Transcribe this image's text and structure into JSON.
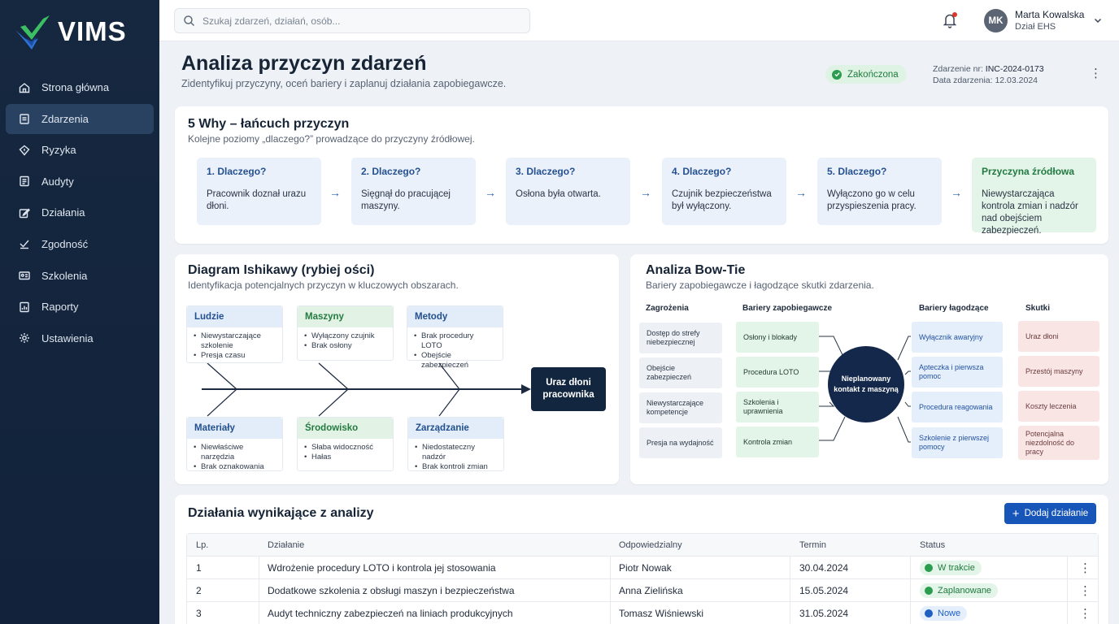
{
  "app": {
    "name": "VIMS"
  },
  "sidebar": {
    "items": [
      {
        "label": "Strona główna",
        "icon": "home-icon"
      },
      {
        "label": "Zdarzenia",
        "icon": "clipboard-icon",
        "active": true
      },
      {
        "label": "Ryzyka",
        "icon": "alert-icon"
      },
      {
        "label": "Audyty",
        "icon": "checklist-icon"
      },
      {
        "label": "Działania",
        "icon": "edit-icon"
      },
      {
        "label": "Zgodność",
        "icon": "check-icon"
      },
      {
        "label": "Szkolenia",
        "icon": "id-card-icon"
      },
      {
        "label": "Raporty",
        "icon": "report-icon"
      },
      {
        "label": "Ustawienia",
        "icon": "gear-icon"
      }
    ]
  },
  "topbar": {
    "search_placeholder": "Szukaj zdarzeń, działań, osób...",
    "user": {
      "initials": "MK",
      "name": "Marta Kowalska",
      "dept": "Dział EHS"
    }
  },
  "header": {
    "title": "Analiza przyczyn zdarzeń",
    "subtitle": "Zidentyfikuj przyczyny, oceń bariery i zaplanuj działania zapobiegawcze.",
    "status": "Zakończona",
    "event_no_label": "Zdarzenie nr:",
    "event_no": "INC-2024-0173",
    "event_date": "Data zdarzenia: 12.03.2024"
  },
  "five_why": {
    "title": "5 Why – łańcuch przyczyn",
    "subtitle": "Kolejne poziomy „dlaczego?” prowadzące do przyczyny źródłowej.",
    "steps": [
      {
        "title": "1. Dlaczego?",
        "text": "Pracownik doznał urazu dłoni."
      },
      {
        "title": "2. Dlaczego?",
        "text": "Sięgnął do pracującej maszyny."
      },
      {
        "title": "3. Dlaczego?",
        "text": "Osłona była otwarta."
      },
      {
        "title": "4. Dlaczego?",
        "text": "Czujnik bezpieczeństwa był wyłączony."
      },
      {
        "title": "5. Dlaczego?",
        "text": "Wyłączono go w celu przyspieszenia pracy."
      },
      {
        "title": "Przyczyna źródłowa",
        "text": "Niewystarczająca kontrola zmian i nadzór nad obejściem zabezpieczeń."
      }
    ]
  },
  "ishikawa": {
    "title": "Diagram Ishikawy (rybiej ości)",
    "subtitle": "Identyfikacja potencjalnych przyczyn w kluczowych obszarach.",
    "categories": [
      {
        "name": "Ludzie",
        "items": [
          "Niewystarczające szkolenie",
          "Presja czasu"
        ]
      },
      {
        "name": "Maszyny",
        "items": [
          "Wyłączony czujnik",
          "Brak osłony"
        ]
      },
      {
        "name": "Metody",
        "items": [
          "Brak procedury LOTO",
          "Obejście zabezpieczeń"
        ]
      },
      {
        "name": "Materiały",
        "items": [
          "Niewłaściwe narzędzia",
          "Brak oznakowania"
        ]
      },
      {
        "name": "Środowisko",
        "items": [
          "Słaba widoczność",
          "Hałas"
        ]
      },
      {
        "name": "Zarządzanie",
        "items": [
          "Niedostateczny nadzór",
          "Brak kontroli zmian"
        ]
      }
    ],
    "effect": "Uraz dłoni pracownika"
  },
  "bowtie": {
    "title": "Analiza Bow-Tie",
    "subtitle": "Bariery zapobiegawcze i łagodzące skutki zdarzenia.",
    "headers": {
      "threats": "Zagrożenia",
      "preventive": "Bariery zapobiegawcze",
      "mitigating": "Bariery łagodzące",
      "consequences": "Skutki"
    },
    "threats": [
      "Dostęp do strefy niebezpiecznej",
      "Obejście zabezpieczeń",
      "Niewystarczające kompetencje",
      "Presja na wydajność"
    ],
    "preventive": [
      "Osłony i blokady",
      "Procedura LOTO",
      "Szkolenia i uprawnienia",
      "Kontrola zmian"
    ],
    "top_event": "Nieplanowany kontakt z maszyną",
    "mitigating": [
      "Wyłącznik awaryjny",
      "Apteczka i pierwsza pomoc",
      "Procedura reagowania",
      "Szkolenie z pierwszej pomocy"
    ],
    "consequences": [
      "Uraz dłoni",
      "Przestój maszyny",
      "Koszty leczenia",
      "Potencjalna niezdolność do pracy"
    ]
  },
  "actions": {
    "title": "Działania wynikające z analizy",
    "add_label": "Dodaj działanie",
    "columns": [
      "Lp.",
      "Działanie",
      "Odpowiedzialny",
      "Termin",
      "Status"
    ],
    "rows": [
      {
        "no": "1",
        "action": "Wdrożenie procedury LOTO i kontrola jej stosowania",
        "owner": "Piotr Nowak",
        "due": "30.04.2024",
        "status": "W trakcie",
        "color": "#2a9d4e",
        "bg": "#e3f4e8"
      },
      {
        "no": "2",
        "action": "Dodatkowe szkolenia z obsługi maszyn i bezpieczeństwa",
        "owner": "Anna Zielińska",
        "due": "15.05.2024",
        "status": "Zaplanowane",
        "color": "#2a9d4e",
        "bg": "#e3f4e8"
      },
      {
        "no": "3",
        "action": "Audyt techniczny zabezpieczeń na liniach produkcyjnych",
        "owner": "Tomasz Wiśniewski",
        "due": "31.05.2024",
        "status": "Nowe",
        "color": "#1f5fc4",
        "bg": "#e5eefb"
      }
    ]
  }
}
